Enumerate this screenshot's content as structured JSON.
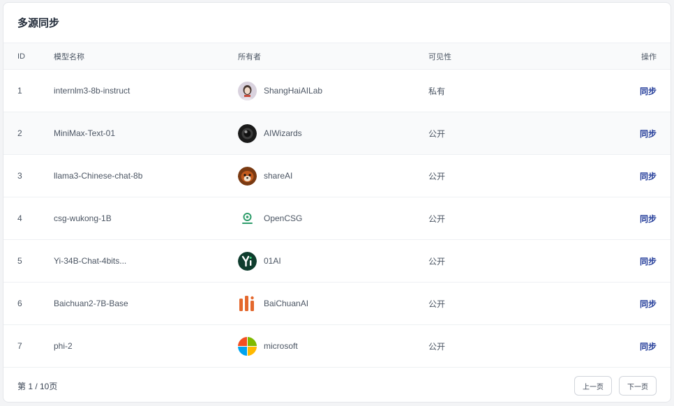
{
  "title": "多源同步",
  "columns": {
    "id": "ID",
    "name": "模型名称",
    "owner": "所有者",
    "visibility": "可见性",
    "action": "操作"
  },
  "rows": [
    {
      "id": "1",
      "name": "internlm3-8b-instruct",
      "owner": "ShangHaiAILab",
      "owner_avatar": "person-photo",
      "visibility": "私有",
      "action": "同步"
    },
    {
      "id": "2",
      "name": "MiniMax-Text-01",
      "owner": "AIWizards",
      "owner_avatar": "camera-lens-logo",
      "visibility": "公开",
      "action": "同步"
    },
    {
      "id": "3",
      "name": "llama3-Chinese-chat-8b",
      "owner": "shareAI",
      "owner_avatar": "red-panda-photo",
      "visibility": "公开",
      "action": "同步"
    },
    {
      "id": "4",
      "name": "csg-wukong-1B",
      "owner": "OpenCSG",
      "owner_avatar": "opencsg-logo",
      "visibility": "公开",
      "action": "同步"
    },
    {
      "id": "5",
      "name": "Yi-34B-Chat-4bits...",
      "owner": "01AI",
      "owner_avatar": "yi-logo",
      "visibility": "公开",
      "action": "同步"
    },
    {
      "id": "6",
      "name": "Baichuan2-7B-Base",
      "owner": "BaiChuanAI",
      "owner_avatar": "baichuan-logo",
      "visibility": "公开",
      "action": "同步"
    },
    {
      "id": "7",
      "name": "phi-2",
      "owner": "microsoft",
      "owner_avatar": "microsoft-logo",
      "visibility": "公开",
      "action": "同步"
    }
  ],
  "pagination": {
    "info": "第 1 / 10页",
    "prev_label": "上一页",
    "next_label": "下一页"
  },
  "colors": {
    "link": "#223b99",
    "header_bg": "#f9fafb",
    "border": "#eef0f3"
  }
}
